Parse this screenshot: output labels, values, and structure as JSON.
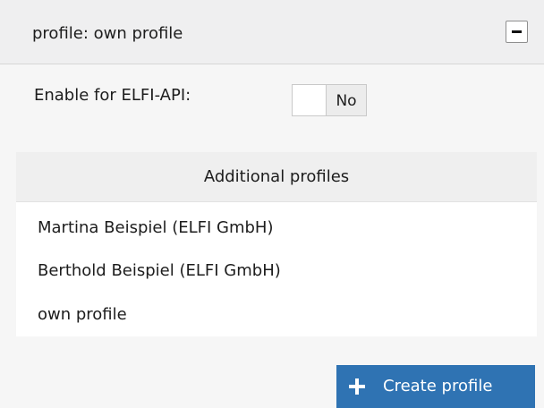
{
  "panel": {
    "title": "profile: own profile",
    "collapse_icon": "minus-icon"
  },
  "settings": {
    "enable_label": "Enable for ELFI-API:",
    "enable_value": "No"
  },
  "profiles": {
    "header": "Additional profiles",
    "items": [
      "Martina Beispiel (ELFI GmbH)",
      "Berthold Beispiel (ELFI GmbH)",
      "own profile"
    ]
  },
  "actions": {
    "create_label": "Create profile",
    "create_icon": "plus-icon",
    "create_color": "#2f73b3"
  }
}
